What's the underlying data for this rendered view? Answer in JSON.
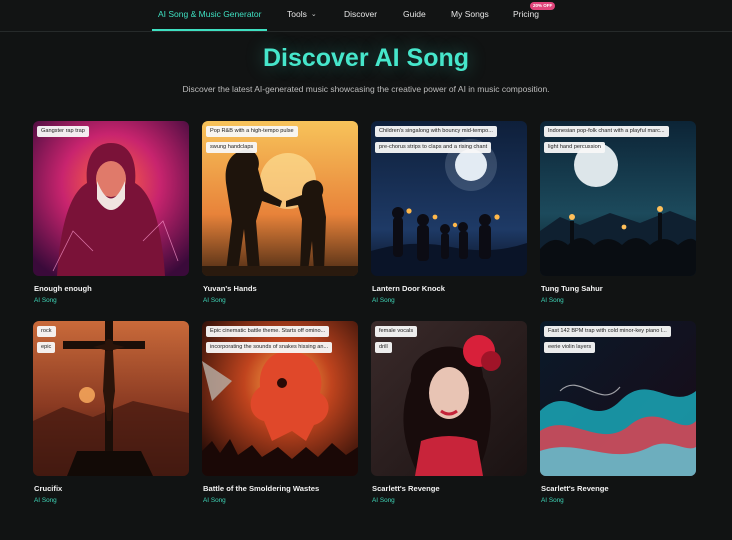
{
  "nav": {
    "items": [
      {
        "label": "AI Song & Music Generator",
        "active": true
      },
      {
        "label": "Tools",
        "dropdown": true
      },
      {
        "label": "Discover"
      },
      {
        "label": "Guide"
      },
      {
        "label": "My Songs"
      },
      {
        "label": "Pricing",
        "badge": "20% OFF"
      }
    ]
  },
  "hero": {
    "title": "Discover AI Song",
    "subtitle": "Discover the latest AI-generated music showcasing the creative power of AI in music composition."
  },
  "colors": {
    "accent": "#3fe0c1",
    "badge": "#e0457b",
    "background": "#111313"
  },
  "songs": [
    {
      "title": "Enough enough",
      "category": "AI Song",
      "tags": [
        "Gangster rap trap"
      ]
    },
    {
      "title": "Yuvan's Hands",
      "category": "AI Song",
      "tags": [
        "Pop R&B with a high-tempo pulse",
        "swung handclaps"
      ]
    },
    {
      "title": "Lantern Door Knock",
      "category": "AI Song",
      "tags": [
        "Children's singalong with bouncy mid-tempo...",
        "pre-chorus strips to claps and a rising chant"
      ]
    },
    {
      "title": "Tung Tung Sahur",
      "category": "AI Song",
      "tags": [
        "Indonesian pop-folk chant with a playful marc...",
        "light hand percussion"
      ]
    },
    {
      "title": "Crucifix",
      "category": "AI Song",
      "tags": [
        "rock",
        "epic"
      ]
    },
    {
      "title": "Battle of the Smoldering Wastes",
      "category": "AI Song",
      "tags": [
        "Epic cinematic battle theme. Starts off omino...",
        "incorporating the sounds of snakes hissing an..."
      ]
    },
    {
      "title": "Scarlett's Revenge",
      "category": "AI Song",
      "tags": [
        "female vocals",
        "drill"
      ]
    },
    {
      "title": "Scarlett's Revenge",
      "category": "AI Song",
      "tags": [
        "Fast 142 BPM trap with cold minor-key piano l...",
        "eerie violin layers"
      ]
    }
  ]
}
